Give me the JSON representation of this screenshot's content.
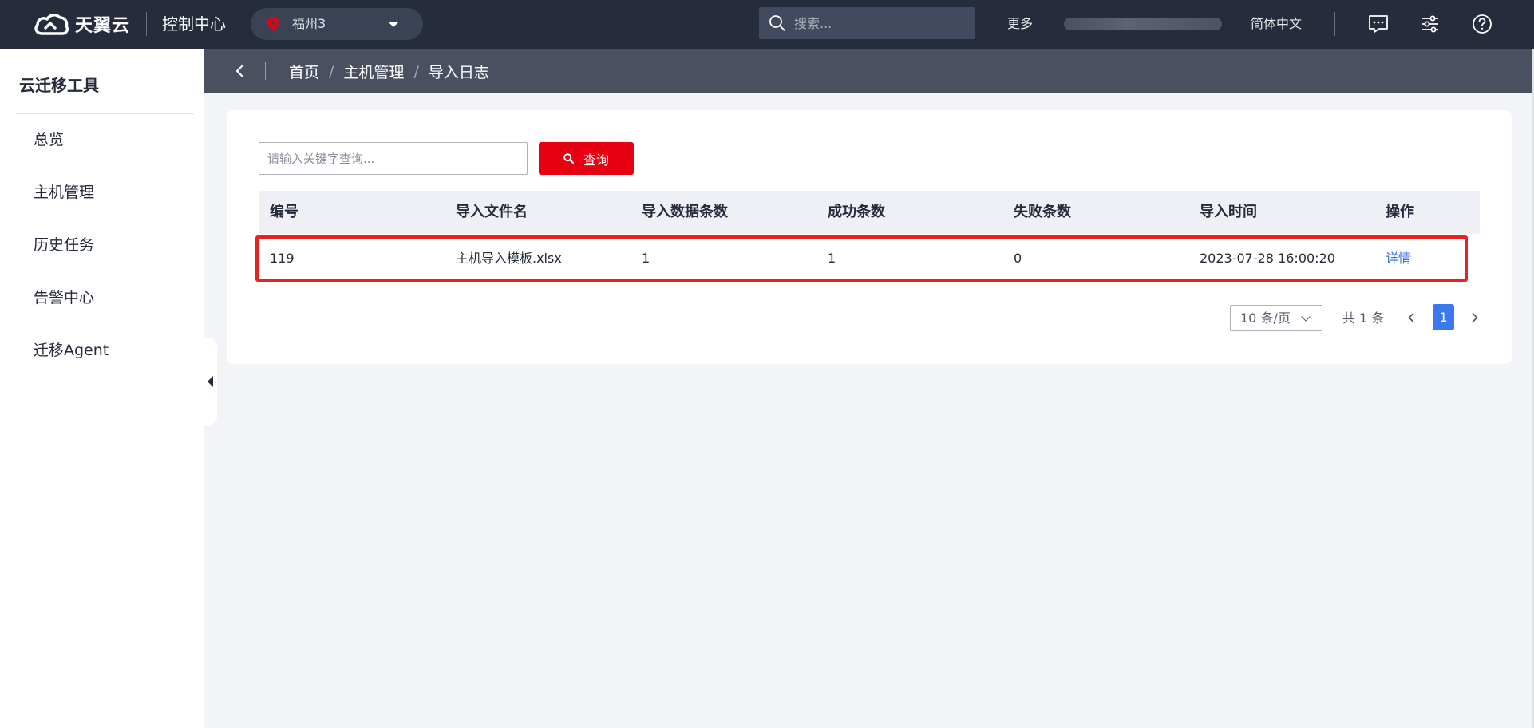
{
  "header": {
    "logo_text": "天翼云",
    "console_title": "控制中心",
    "region": "福州3",
    "search_placeholder": "搜索...",
    "more": "更多",
    "language": "简体中文",
    "icons": [
      "message-icon",
      "settings-sliders-icon",
      "help-icon"
    ],
    "accent": "#e60012"
  },
  "sidebar": {
    "title": "云迁移工具",
    "items": [
      {
        "label": "总览"
      },
      {
        "label": "主机管理"
      },
      {
        "label": "历史任务"
      },
      {
        "label": "告警中心"
      },
      {
        "label": "迁移Agent"
      }
    ]
  },
  "breadcrumb": {
    "items": [
      "首页",
      "主机管理",
      "导入日志"
    ]
  },
  "filter": {
    "keyword_placeholder": "请输入关键字查询...",
    "query_label": "查询"
  },
  "table": {
    "columns": [
      "编号",
      "导入文件名",
      "导入数据条数",
      "成功条数",
      "失败条数",
      "导入时间",
      "操作"
    ],
    "rows": [
      {
        "id": "119",
        "file": "主机导入模板.xlsx",
        "total": "1",
        "success": "1",
        "failed": "0",
        "time": "2023-07-28 16:00:20",
        "action": "详情"
      }
    ],
    "highlight_color": "#e8231f"
  },
  "pagination": {
    "page_size": "10 条/页",
    "total": "共 1 条",
    "current_page": "1",
    "active_color": "#3b78ee"
  }
}
